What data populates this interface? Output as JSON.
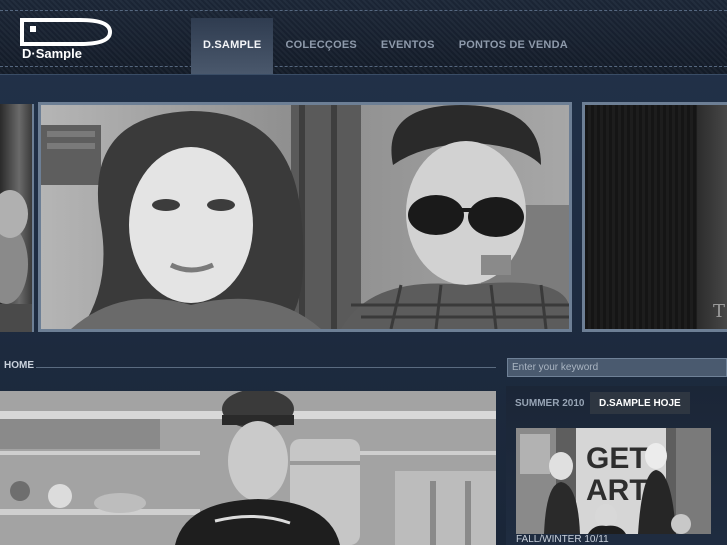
{
  "brand": {
    "logo_text": "D·Sample"
  },
  "nav": {
    "items": [
      {
        "label": "D.SAMPLE",
        "active": true
      },
      {
        "label": "COLECÇOES",
        "active": false
      },
      {
        "label": "EVENTOS",
        "active": false
      },
      {
        "label": "PONTOS DE VENDA",
        "active": false
      }
    ]
  },
  "hero": {
    "side_letter": "T"
  },
  "breadcrumb": {
    "home": "HOME"
  },
  "search": {
    "placeholder": "Enter your keyword"
  },
  "sidebar": {
    "tabs": [
      "SUMMER 2010",
      "D.SAMPLE HOJE"
    ],
    "caption": "FALL/WINTER 10/11"
  },
  "colors": {
    "accent": "#6d7f95",
    "header_bg": "#141c29",
    "page_bg": "#1e2b3c"
  }
}
